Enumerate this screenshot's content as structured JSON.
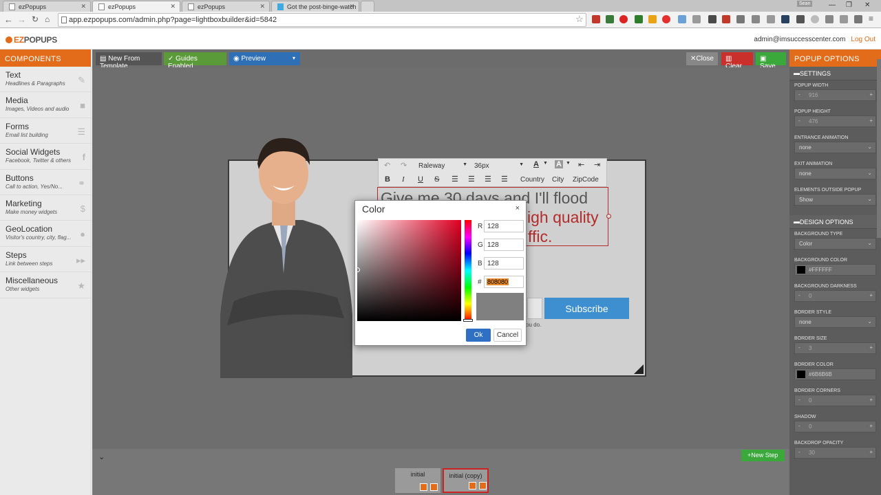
{
  "browser": {
    "tabs": [
      {
        "label": "ezPopups"
      },
      {
        "label": "ezPopups"
      },
      {
        "label": "ezPopups"
      },
      {
        "label": "Got the post-binge-watch"
      }
    ],
    "url": "app.ezpopups.com/admin.php?page=lightboxbuilder&id=5842",
    "profile_label": "Sean"
  },
  "app": {
    "logo": {
      "prefix": "EZ",
      "suffix": "POPUPS"
    },
    "user_email": "admin@imsuccesscenter.com",
    "logout_label": "Log Out"
  },
  "components": {
    "header": "COMPONENTS",
    "items": [
      {
        "title": "Text",
        "subtitle": "Headlines & Paragraphs",
        "icon": "pencil-icon"
      },
      {
        "title": "Media",
        "subtitle": "Images, Videos and audio",
        "icon": "video-camera-icon"
      },
      {
        "title": "Forms",
        "subtitle": "Email list building",
        "icon": "list-icon"
      },
      {
        "title": "Social Widgets",
        "subtitle": "Facebook, Twitter & others",
        "icon": "facebook-icon"
      },
      {
        "title": "Buttons",
        "subtitle": "Call to action, Yes/No...",
        "icon": "link-icon"
      },
      {
        "title": "Marketing",
        "subtitle": "Make money widgets",
        "icon": "dollar-icon"
      },
      {
        "title": "GeoLocation",
        "subtitle": "Visitor's country, city, flag...",
        "icon": "globe-icon"
      },
      {
        "title": "Steps",
        "subtitle": "Link between steps",
        "icon": "fast-forward-icon"
      },
      {
        "title": "Miscellaneous",
        "subtitle": "Other widgets",
        "icon": "star-icon"
      }
    ]
  },
  "toolbar": {
    "new_from_template": "New From Template",
    "guides_enabled": "Guides Enabled",
    "preview": "Preview",
    "close": "Close",
    "clear": "Clear",
    "save": "Save",
    "colors": {
      "guides": "#5b9a38",
      "preview": "#2f6fb5",
      "clear": "#c9302c",
      "save": "#3aa83a"
    }
  },
  "popup": {
    "headline_line1": "Give me 30 days and I'll flood",
    "headline_line2": "igh quality",
    "headline_line3": "ffic.",
    "subscribe_label": "Subscribe",
    "caption_fragment": "ou do.",
    "editor": {
      "font": "Raleway",
      "size": "36px",
      "tags": [
        "Country",
        "City",
        "ZipCode"
      ]
    }
  },
  "color_dialog": {
    "title": "Color",
    "close": "×",
    "r_label": "R",
    "r_value": "128",
    "g_label": "G",
    "g_value": "128",
    "b_label": "B",
    "b_value": "128",
    "hex_label": "#",
    "hex_value": "808080",
    "preview_color": "#808080",
    "ok_label": "Ok",
    "cancel_label": "Cancel"
  },
  "popup_options": {
    "header": "POPUP OPTIONS",
    "settings_header": "SETTINGS",
    "design_header": "DESIGN OPTIONS",
    "settings": [
      {
        "label": "POPUP WIDTH",
        "value": "916",
        "kind": "number"
      },
      {
        "label": "POPUP HEIGHT",
        "value": "476",
        "kind": "number"
      },
      {
        "label": "ENTRANCE ANIMATION",
        "value": "none",
        "kind": "select"
      },
      {
        "label": "EXIT ANIMATION",
        "value": "none",
        "kind": "select"
      },
      {
        "label": "ELEMENTS OUTSIDE POPUP",
        "value": "Show",
        "kind": "select"
      }
    ],
    "design": [
      {
        "label": "BACKGROUND TYPE",
        "value": "Color",
        "kind": "select"
      },
      {
        "label": "BACKGROUND COLOR",
        "value": "#FFFFFF",
        "kind": "color"
      },
      {
        "label": "BACKGROUND DARKNESS",
        "value": "0",
        "kind": "number"
      },
      {
        "label": "BORDER STYLE",
        "value": "none",
        "kind": "select"
      },
      {
        "label": "BORDER SIZE",
        "value": "3",
        "kind": "number"
      },
      {
        "label": "BORDER COLOR",
        "value": "#6B6B6B",
        "kind": "color"
      },
      {
        "label": "BORDER CORNERS",
        "value": "0",
        "kind": "number"
      },
      {
        "label": "SHADOW",
        "value": "0",
        "kind": "number"
      },
      {
        "label": "BACKDROP OPACITY",
        "value": "30",
        "kind": "number"
      }
    ]
  },
  "steps": {
    "new_step_label": "New Step",
    "items": [
      {
        "label": "initial"
      },
      {
        "label": "initial (copy)"
      }
    ]
  }
}
